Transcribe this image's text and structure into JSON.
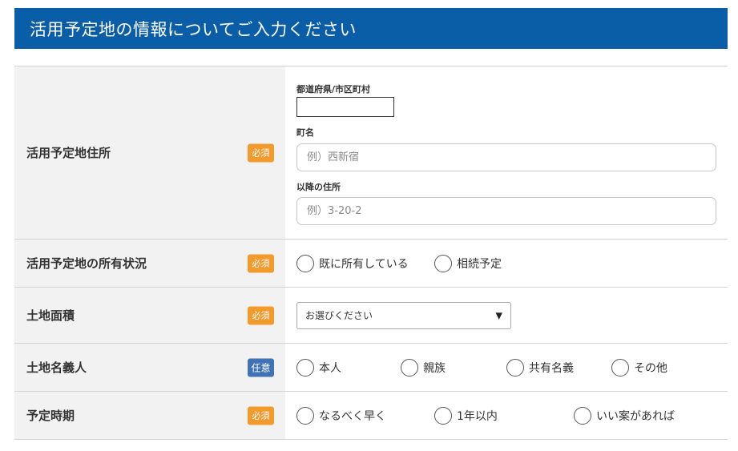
{
  "header": {
    "title": "活用予定地の情報についてご入力ください"
  },
  "badges": {
    "required": "必須",
    "optional": "任意"
  },
  "rows": {
    "address": {
      "label": "活用予定地住所",
      "prefecture_label": "都道府県/市区町村",
      "town_label": "町名",
      "town_placeholder": "例）西新宿",
      "rest_label": "以降の住所",
      "rest_placeholder": "例）3-20-2"
    },
    "ownership": {
      "label": "活用予定地の所有状況",
      "options": [
        "既に所有している",
        "相続予定"
      ]
    },
    "land_area": {
      "label": "土地面積",
      "select_value": "お選びください",
      "arrow_icon": "▼"
    },
    "owner_name": {
      "label": "土地名義人",
      "options": [
        "本人",
        "親族",
        "共有名義",
        "その他"
      ]
    },
    "timing": {
      "label": "予定時期",
      "options": [
        "なるべく早く",
        "1年以内",
        "いい案があれば"
      ]
    }
  },
  "colors": {
    "header_bg": "#0a5ea8",
    "required_badge": "#f39a2d",
    "optional_badge": "#3f73b5",
    "label_bg": "#f2f2f2"
  }
}
